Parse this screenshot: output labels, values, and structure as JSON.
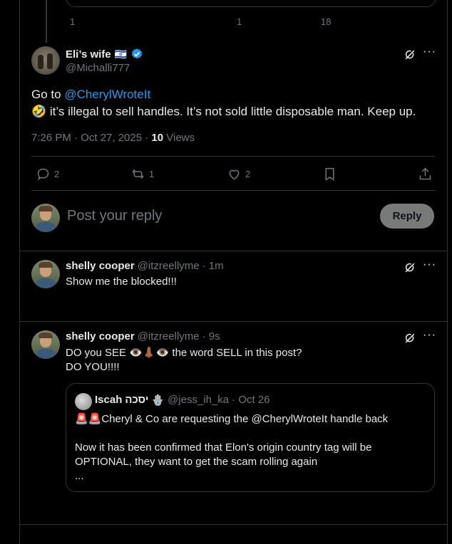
{
  "prev_tweet": {
    "reply_count": "1",
    "like_count": "1",
    "view_count": "18"
  },
  "main_tweet": {
    "display_name": "Eli’s wife",
    "flag_emoji": "🇮🇱",
    "handle": "@Michalli777",
    "text_go_to": "Go to ",
    "mention": "@CherylWroteIt",
    "emoji": "🤣",
    "text_body": " it’s illegal to sell handles. It’s not sold little disposable man. Keep up.",
    "time": "7:26 PM · Oct 27, 2025 · ",
    "views_number": "10",
    "views_label": " Views",
    "reply_count": "2",
    "retweet_count": "1",
    "like_count": "2"
  },
  "compose": {
    "placeholder": "Post your reply",
    "reply_button": "Reply"
  },
  "reply1": {
    "display_name": "shelly cooper",
    "handle": "@itzreellyme",
    "time": "· 1m",
    "text": "Show me the blocked!!!"
  },
  "reply2": {
    "display_name": "shelly cooper",
    "handle": "@itzreellyme",
    "time": "· 9s",
    "text_line1_a": "DO you SEE ",
    "text_line1_emojis": "👁️👃🏾👁️",
    "text_line1_b": " the word SELL in this post?",
    "text_line2": "DO YOU!!!!",
    "quote": {
      "display_name": "Iscah",
      "name_suffix": "יסכה",
      "decor_emoji": "🪬",
      "handle": "@jess_ih_ka",
      "time": "· Oct 26",
      "siren_emojis": "🚨🚨",
      "line1": "Cheryl & Co are requesting the @CherylWroteIt handle back",
      "line2": "Now it has been confirmed that Elon's origin country tag will be",
      "line3": "OPTIONAL, they want to get the scam rolling again",
      "ellipsis": "..."
    }
  },
  "colors": {
    "background": "#000000",
    "text": "#e7e9ea",
    "muted": "#71767b",
    "link": "#1d9bf0",
    "border": "#2f3336",
    "verified": "#1d9bf0"
  }
}
